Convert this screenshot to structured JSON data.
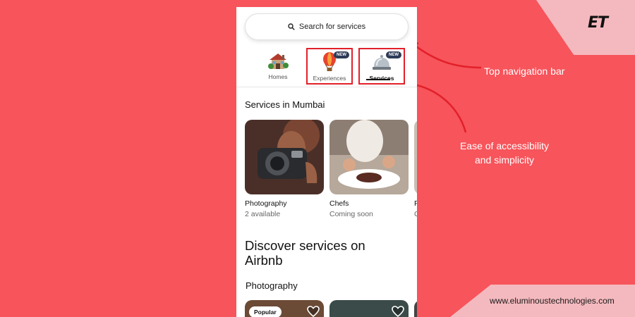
{
  "branding": {
    "logo_text": "ET",
    "website": "www.eluminoustechnologies.com"
  },
  "callouts": {
    "top_nav": "Top navigation bar",
    "ease_line1": "Ease of accessibility",
    "ease_line2": "and simplicity"
  },
  "colors": {
    "background": "#f7545b",
    "corner_accent": "#f4b9be",
    "highlight_border": "#e2202a",
    "badge": "#2c3a57"
  },
  "app": {
    "search": {
      "label": "Search for services",
      "icon": "search-icon"
    },
    "tabs": [
      {
        "label": "Homes",
        "icon": "house-icon",
        "badge": "",
        "active": false
      },
      {
        "label": "Experiences",
        "icon": "hot-air-balloon-icon",
        "badge": "NEW",
        "active": false
      },
      {
        "label": "Services",
        "icon": "service-bell-icon",
        "badge": "NEW",
        "active": true
      }
    ],
    "section_title": "Services in Mumbai",
    "services": [
      {
        "title": "Photography",
        "subtitle": "2 available"
      },
      {
        "title": "Chefs",
        "subtitle": "Coming soon"
      },
      {
        "title": "P",
        "subtitle": "C"
      }
    ],
    "discover_title": "Discover services on Airbnb",
    "photography_title": "Photography",
    "popular_badge": "Popular"
  }
}
